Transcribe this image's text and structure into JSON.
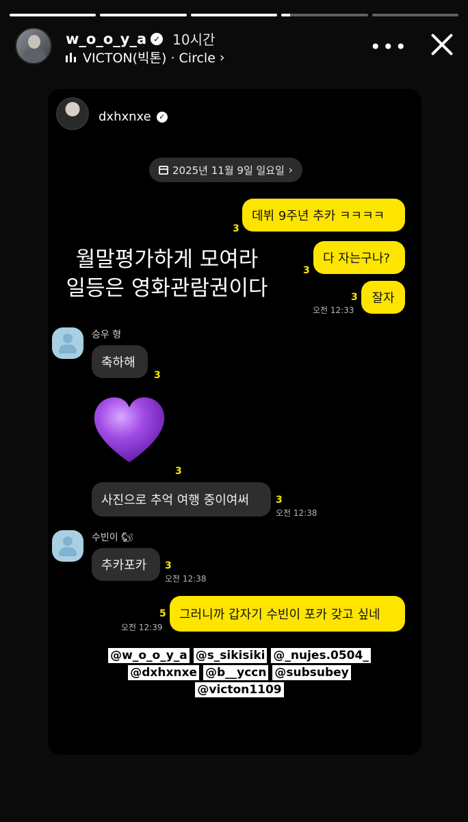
{
  "story": {
    "progress": [
      1,
      1,
      1,
      0.1,
      0
    ],
    "username": "w_o_o_y_a",
    "time_ago": "10시간",
    "music_label": "VICTON(빅톤) · Circle",
    "more_label": "•••"
  },
  "shared_post": {
    "handle": "dxhxnxe",
    "date_chip": "2025년 11월 9일 일요일",
    "overlay_line1": "월말평가하게  모여라",
    "overlay_line2": "일등은  영화관람권이다",
    "messages": {
      "m1": {
        "text": "데뷔 9주년 추카 ㅋㅋㅋㅋ",
        "count": "3"
      },
      "m2": {
        "text": "다 자는구나?",
        "count": "3"
      },
      "m3": {
        "text": "잘자",
        "count": "3",
        "time": "오전 12:33"
      },
      "s1_name": "승우 형",
      "m4": {
        "text": "축하해",
        "count": "3"
      },
      "m5": {
        "emoji": "purple-heart",
        "count": "3"
      },
      "m6": {
        "text": "사진으로 추억 여행 중이여써",
        "count": "3",
        "time": "오전 12:38"
      },
      "s2_name": "수빈이 🐿",
      "m7": {
        "text": "추카포카",
        "count": "3",
        "time": "오전 12:38"
      },
      "m8": {
        "text": "그러니까 갑자기 수빈이 포카 갖고 싶네",
        "count": "5",
        "time": "오전 12:39"
      }
    },
    "mentions": {
      "line1": [
        "@w_o_o_y_a",
        "@s_sikisiki",
        "@_nujes.0504_"
      ],
      "line2": [
        "@dxhxnxe",
        "@b__yccn",
        "@subsubey"
      ],
      "line3": [
        "@victon1109"
      ]
    }
  },
  "colors": {
    "kakao_yellow": "#fee500",
    "bubble_dark": "#2e2e2e",
    "heart": "#a24de6"
  }
}
